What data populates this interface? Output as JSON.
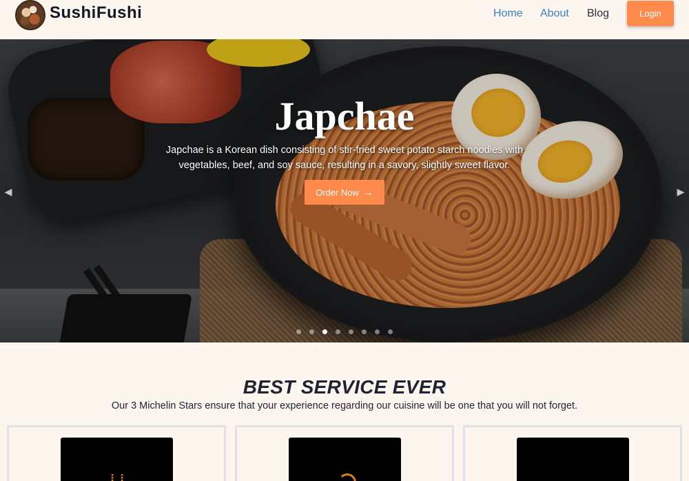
{
  "navbar": {
    "brand": "SushiFushi",
    "links": [
      {
        "label": "Home"
      },
      {
        "label": "About"
      },
      {
        "label": "Blog"
      }
    ],
    "login_label": "Login"
  },
  "hero": {
    "title": "Japchae",
    "description": "Japchae is a Korean dish consisting of stir-fried sweet potato starch noodles with vegetables, beef, and soy sauce, resulting in a savory, slightly sweet flavor.",
    "cta_label": "Order Now",
    "cta_icon": "arrow-right-icon",
    "prev_icon": "chevron-left-icon",
    "next_icon": "chevron-right-icon",
    "slide_count": 8,
    "active_slide": 3
  },
  "service": {
    "title": "BEST SERVICE EVER",
    "subtitle": "Our 3 Michelin Stars ensure that your experience regarding our cuisine will be one that you will not forget."
  },
  "colors": {
    "accent": "#ff8a4c",
    "link": "#3b82c4",
    "background": "#fdf6ee"
  }
}
